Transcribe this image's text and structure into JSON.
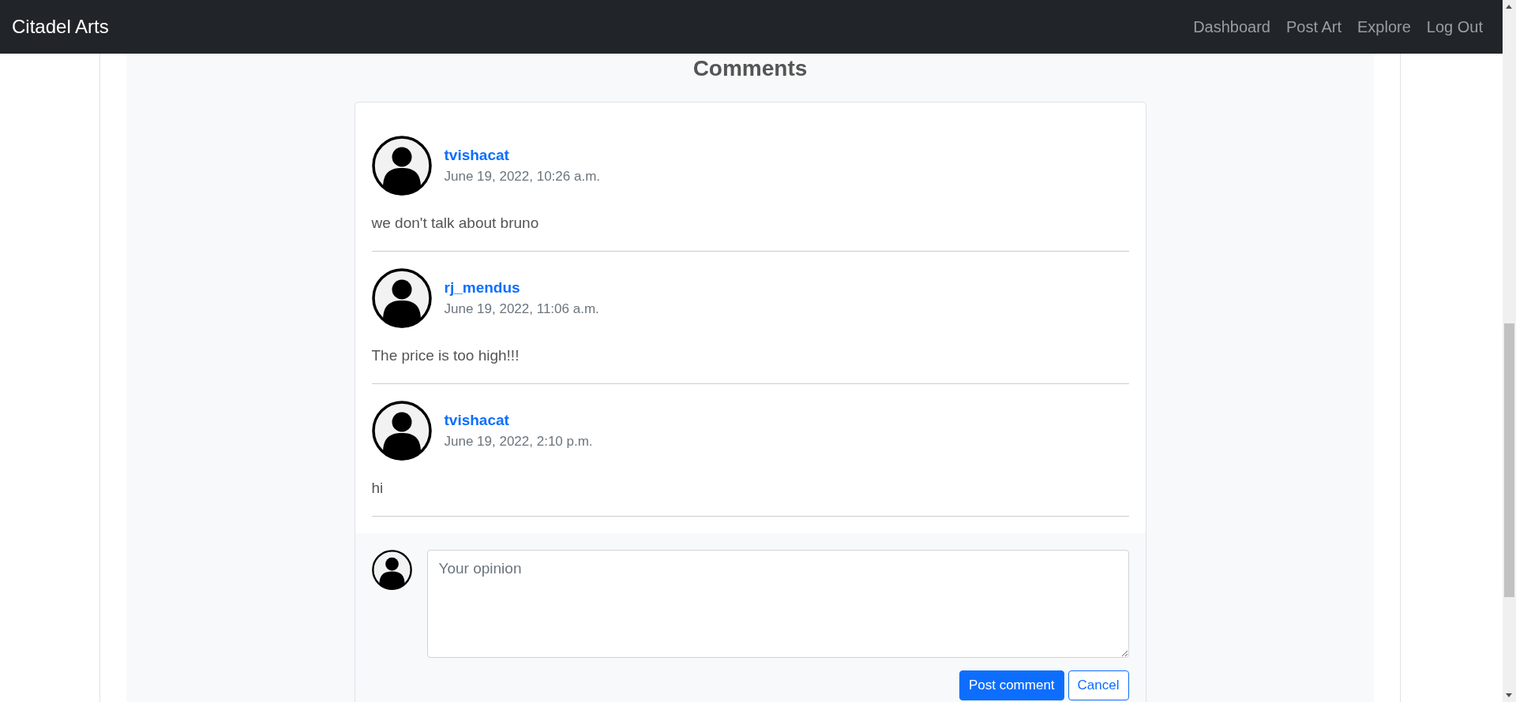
{
  "navbar": {
    "brand": "Citadel Arts",
    "links": [
      {
        "label": "Dashboard"
      },
      {
        "label": "Post Art"
      },
      {
        "label": "Explore"
      },
      {
        "label": "Log Out"
      }
    ]
  },
  "comments_section": {
    "heading": "Comments",
    "comments": [
      {
        "author": "tvishacat",
        "date": "June 19, 2022, 10:26 a.m.",
        "text": "we don't talk about bruno"
      },
      {
        "author": "rj_mendus",
        "date": "June 19, 2022, 11:06 a.m.",
        "text": "The price is too high!!!"
      },
      {
        "author": "tvishacat",
        "date": "June 19, 2022, 2:10 p.m.",
        "text": "hi"
      }
    ],
    "form": {
      "placeholder": "Your opinion",
      "buttons": [
        {
          "label": "Post comment",
          "kind": "primary"
        },
        {
          "label": "Cancel",
          "kind": "outline"
        }
      ]
    }
  }
}
